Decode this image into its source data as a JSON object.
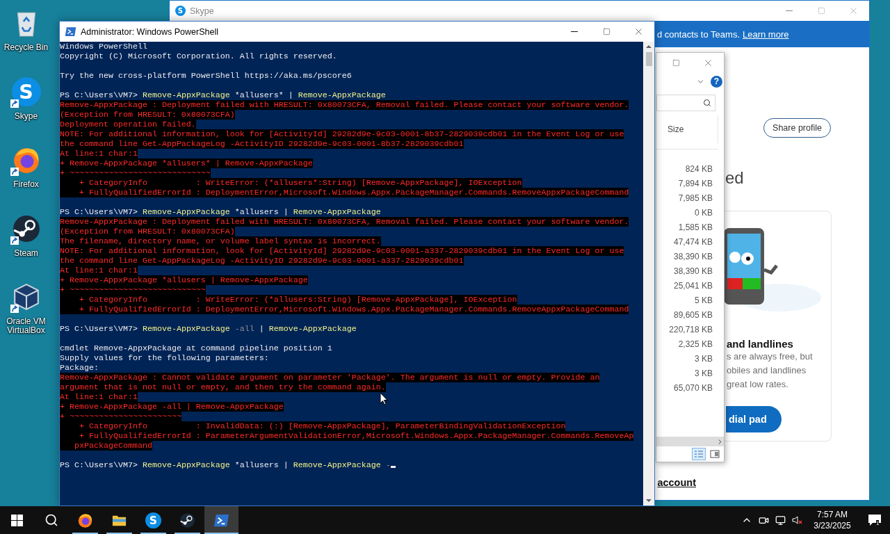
{
  "desktop_icons": [
    {
      "label": "Recycle Bin",
      "kind": "recycle",
      "shortcut": false
    },
    {
      "label": "Skype",
      "kind": "skype",
      "glyph": "S",
      "shortcut": true
    },
    {
      "label": "Firefox",
      "kind": "firefox",
      "shortcut": true
    },
    {
      "label": "Steam",
      "kind": "steam",
      "shortcut": true
    },
    {
      "label": "Oracle VM VirtualBox",
      "kind": "virtualbox",
      "shortcut": true
    }
  ],
  "skype_window": {
    "title": "Skype",
    "title_glyph": "S",
    "banner": {
      "text": "d contacts to Teams.",
      "link": "Learn more"
    },
    "share_button": "Share profile",
    "heading": "ed",
    "card": {
      "title": "and landlines",
      "lines": [
        "s are always free, but",
        "obiles and landlines",
        "great low rates."
      ],
      "button": "dial pad"
    },
    "account_link": "account"
  },
  "explorer_window": {
    "help_glyph": "?",
    "column": "Size",
    "sizes": [
      "824 KB",
      "7,894 KB",
      "7,985 KB",
      "0 KB",
      "1,585 KB",
      "47,474 KB",
      "38,390 KB",
      "38,390 KB",
      "25,041 KB",
      "5 KB",
      "89,605 KB",
      "220,718 KB",
      "2,325 KB",
      "3 KB",
      "3 KB",
      "65,070 KB"
    ],
    "view_buttons": [
      {
        "kind": "details",
        "selected": true
      },
      {
        "kind": "preview",
        "selected": false
      }
    ]
  },
  "powershell_window": {
    "title": "Administrator: Windows PowerShell",
    "lines": [
      {
        "kind": "output",
        "text": "Windows PowerShell"
      },
      {
        "kind": "output",
        "text": "Copyright (C) Microsoft Corporation. All rights reserved."
      },
      {
        "kind": "blank"
      },
      {
        "kind": "output",
        "text": "Try the new cross-platform PowerShell https://aka.ms/pscore6"
      },
      {
        "kind": "blank"
      },
      {
        "kind": "command",
        "prompt": "PS C:\\Users\\VM7> ",
        "tokens": [
          {
            "kind": "cmd",
            "text": "Remove-AppxPackage"
          },
          {
            "kind": "plain",
            "text": " *allusers* | "
          },
          {
            "kind": "cmd",
            "text": "Remove-AppxPackage"
          }
        ],
        "cursor": false
      },
      {
        "kind": "error",
        "text": "Remove-AppxPackage : Deployment failed with HRESULT: 0x80073CFA, Removal failed. Please contact your software vendor."
      },
      {
        "kind": "error",
        "text": "(Exception from HRESULT: 0x80073CFA)"
      },
      {
        "kind": "error",
        "text": "Deployment operation failed."
      },
      {
        "kind": "error",
        "text": "NOTE: For additional information, look for [ActivityId] 29282d9e-9c03-0001-8b37-2829039cdb01 in the Event Log or use"
      },
      {
        "kind": "error",
        "text": "the command line Get-AppPackageLog -ActivityID 29282d9e-9c03-0001-8b37-2829039cdb01"
      },
      {
        "kind": "error",
        "text": "At line:1 char:1"
      },
      {
        "kind": "error",
        "text": "+ Remove-AppxPackage *allusers* | Remove-AppxPackage"
      },
      {
        "kind": "error",
        "text": "+ ~~~~~~~~~~~~~~~~~~~~~~~~~~~~~"
      },
      {
        "kind": "error",
        "text": "    + CategoryInfo          : WriteError: (*allusers*:String) [Remove-AppxPackage], IOException"
      },
      {
        "kind": "error",
        "text": "    + FullyQualifiedErrorId : DeploymentError,Microsoft.Windows.Appx.PackageManager.Commands.RemoveAppxPackageCommand"
      },
      {
        "kind": "blank"
      },
      {
        "kind": "command",
        "prompt": "PS C:\\Users\\VM7> ",
        "tokens": [
          {
            "kind": "cmd",
            "text": "Remove-AppxPackage"
          },
          {
            "kind": "plain",
            "text": " *allusers | "
          },
          {
            "kind": "cmd",
            "text": "Remove-AppxPackage"
          }
        ],
        "cursor": false
      },
      {
        "kind": "error",
        "text": "Remove-AppxPackage : Deployment failed with HRESULT: 0x80073CFA, Removal failed. Please contact your software vendor."
      },
      {
        "kind": "error",
        "text": "(Exception from HRESULT: 0x80073CFA)"
      },
      {
        "kind": "error",
        "text": "The filename, directory name, or volume label syntax is incorrect."
      },
      {
        "kind": "error",
        "text": "NOTE: For additional information, look for [ActivityId] 29282d9e-9c03-0001-a337-2829039cdb01 in the Event Log or use"
      },
      {
        "kind": "error",
        "text": "the command line Get-AppPackageLog -ActivityID 29282d9e-9c03-0001-a337-2829039cdb01"
      },
      {
        "kind": "error",
        "text": "At line:1 char:1"
      },
      {
        "kind": "error",
        "text": "+ Remove-AppxPackage *allusers | Remove-AppxPackage"
      },
      {
        "kind": "error",
        "text": "+ ~~~~~~~~~~~~~~~~~~~~~~~~~~~~"
      },
      {
        "kind": "error",
        "text": "    + CategoryInfo          : WriteError: (*allusers:String) [Remove-AppxPackage], IOException"
      },
      {
        "kind": "error",
        "text": "    + FullyQualifiedErrorId : DeploymentError,Microsoft.Windows.Appx.PackageManager.Commands.RemoveAppxPackageCommand"
      },
      {
        "kind": "blank"
      },
      {
        "kind": "command",
        "prompt": "PS C:\\Users\\VM7> ",
        "tokens": [
          {
            "kind": "cmd",
            "text": "Remove-AppxPackage"
          },
          {
            "kind": "param",
            "text": " -all"
          },
          {
            "kind": "plain",
            "text": " | "
          },
          {
            "kind": "cmd",
            "text": "Remove-AppxPackage"
          }
        ],
        "cursor": false
      },
      {
        "kind": "blank"
      },
      {
        "kind": "output",
        "text": "cmdlet Remove-AppxPackage at command pipeline position 1"
      },
      {
        "kind": "output",
        "text": "Supply values for the following parameters:"
      },
      {
        "kind": "output",
        "text": "Package:"
      },
      {
        "kind": "error",
        "text": "Remove-AppxPackage : Cannot validate argument on parameter 'Package'. The argument is null or empty. Provide an"
      },
      {
        "kind": "error",
        "text": "argument that is not null or empty, and then try the command again."
      },
      {
        "kind": "error",
        "text": "At line:1 char:1"
      },
      {
        "kind": "error",
        "text": "+ Remove-AppxPackage -all | Remove-AppxPackage"
      },
      {
        "kind": "error",
        "text": "+ ~~~~~~~~~~~~~~~~~~~~~~~"
      },
      {
        "kind": "error",
        "text": "    + CategoryInfo          : InvalidData: (:) [Remove-AppxPackage], ParameterBindingValidationException"
      },
      {
        "kind": "error",
        "text": "    + FullyQualifiedErrorId : ParameterArgumentValidationError,Microsoft.Windows.Appx.PackageManager.Commands.RemoveAp"
      },
      {
        "kind": "error",
        "text": "   pxPackageCommand"
      },
      {
        "kind": "blank"
      },
      {
        "kind": "command",
        "prompt": "PS C:\\Users\\VM7> ",
        "tokens": [
          {
            "kind": "cmd",
            "text": "Remove-AppxPackage"
          },
          {
            "kind": "plain",
            "text": " *allusers | "
          },
          {
            "kind": "cmd",
            "text": "Remove-AppxPackage"
          },
          {
            "kind": "param",
            "text": " -"
          }
        ],
        "cursor": true
      }
    ]
  },
  "taskbar": {
    "items": [
      {
        "kind": "firefox",
        "running": true,
        "active": false
      },
      {
        "kind": "explorer",
        "running": true,
        "active": false
      },
      {
        "kind": "skype",
        "glyph": "S",
        "running": true,
        "active": false
      },
      {
        "kind": "steam",
        "running": true,
        "active": false
      },
      {
        "kind": "powershell",
        "running": true,
        "active": true
      }
    ],
    "time": "7:57 AM",
    "date": "3/23/2025",
    "notification_count": "1"
  }
}
